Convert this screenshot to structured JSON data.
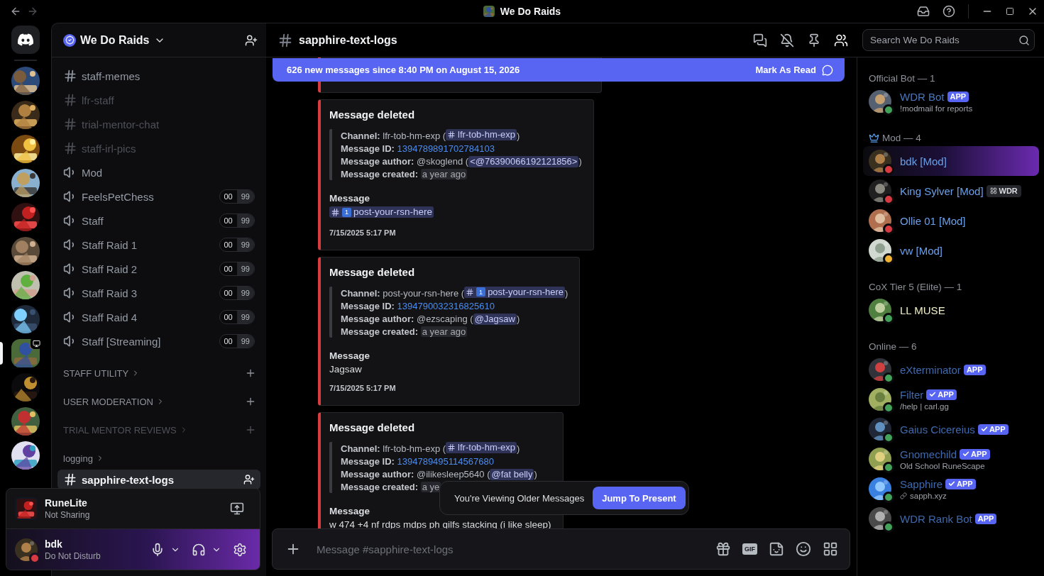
{
  "window": {
    "title": "We Do Raids"
  },
  "servers": [
    {
      "selected": false,
      "live": false
    },
    {
      "selected": false,
      "live": false
    },
    {
      "selected": false,
      "live": false
    },
    {
      "selected": false,
      "live": false
    },
    {
      "selected": false,
      "live": false
    },
    {
      "selected": false,
      "live": false
    },
    {
      "selected": false,
      "live": false
    },
    {
      "selected": false,
      "live": false
    },
    {
      "selected": true,
      "live": true
    },
    {
      "selected": false,
      "live": false
    },
    {
      "selected": false,
      "live": false
    },
    {
      "selected": false,
      "live": false
    }
  ],
  "server_header": {
    "name": "We Do Raids"
  },
  "channels": [
    {
      "kind": "text",
      "name": "staff-memes",
      "muted": false,
      "selected": false
    },
    {
      "kind": "text",
      "name": "lfr-staff",
      "muted": true,
      "selected": false
    },
    {
      "kind": "text",
      "name": "trial-mentor-chat",
      "muted": true,
      "selected": false
    },
    {
      "kind": "text",
      "name": "staff-irl-pics",
      "muted": true,
      "selected": false
    },
    {
      "kind": "voice",
      "name": "Mod",
      "muted": false,
      "selected": false
    },
    {
      "kind": "voice",
      "name": "FeelsPetChess",
      "muted": false,
      "selected": false,
      "count": "00",
      "limit": "99"
    },
    {
      "kind": "voice",
      "name": "Staff",
      "muted": false,
      "selected": false,
      "count": "00",
      "limit": "99"
    },
    {
      "kind": "voice",
      "name": "Staff Raid 1",
      "muted": false,
      "selected": false,
      "count": "00",
      "limit": "99"
    },
    {
      "kind": "voice",
      "name": "Staff Raid 2",
      "muted": false,
      "selected": false,
      "count": "00",
      "limit": "99"
    },
    {
      "kind": "voice",
      "name": "Staff Raid 3",
      "muted": false,
      "selected": false,
      "count": "00",
      "limit": "99"
    },
    {
      "kind": "voice",
      "name": "Staff Raid 4",
      "muted": false,
      "selected": false,
      "count": "00",
      "limit": "99"
    },
    {
      "kind": "voice",
      "name": "Staff [Streaming]",
      "muted": false,
      "selected": false,
      "count": "00",
      "limit": "99"
    },
    {
      "kind": "category",
      "name": "STAFF UTILITY",
      "muted": false,
      "add": true
    },
    {
      "kind": "category",
      "name": "USER MODERATION",
      "muted": false,
      "add": true
    },
    {
      "kind": "category",
      "name": "TRIAL MENTOR REVIEWS",
      "muted": true,
      "add": true
    },
    {
      "kind": "category",
      "name": "logging",
      "muted": false,
      "add": false
    },
    {
      "kind": "text",
      "name": "sapphire-text-logs",
      "muted": false,
      "selected": true
    }
  ],
  "activity": {
    "app": "RuneLite",
    "status": "Not Sharing"
  },
  "user": {
    "name": "bdk",
    "status": "Do Not Disturb",
    "color": "#d83a42"
  },
  "channel_header": {
    "name": "sapphire-text-logs"
  },
  "search": {
    "placeholder": "Search We Do Raids"
  },
  "banner": {
    "text": "626 new messages since 8:40 PM on August 15, 2026",
    "action": "Mark As Read"
  },
  "embeds": [
    {
      "kind": "stub"
    },
    {
      "kind": "embed",
      "title": "Message deleted",
      "fields": [
        {
          "kind": "channel",
          "label": "Channel:",
          "text": "lfr-tob-hm-exp (",
          "mention": "lfr-tob-hm-exp",
          "close": ")"
        },
        {
          "kind": "link",
          "label": "Message ID:",
          "text": "1394789891702784103"
        },
        {
          "kind": "mention",
          "label": "Message author:",
          "text": "@skoglend (",
          "mention": "<@763900661921218​56>",
          "close": ")"
        },
        {
          "kind": "timestamp",
          "label": "Message created:",
          "text": "a year ago"
        }
      ],
      "message_label": "Message",
      "content": {
        "kind": "channel",
        "keycap": "1",
        "mention": "post-your-rsn-here"
      },
      "time": "7/15/2025 5:17 PM"
    },
    {
      "kind": "embed",
      "title": "Message deleted",
      "fields": [
        {
          "kind": "channel",
          "label": "Channel:",
          "text": "post-your-rsn-here (",
          "keycap": "1",
          "mention": "post-your-rsn-here",
          "close": ")"
        },
        {
          "kind": "link",
          "label": "Message ID:",
          "text": "1394790032316825610"
        },
        {
          "kind": "mention",
          "label": "Message author:",
          "text": "@ezscaping (",
          "mention": "@Jagsaw",
          "close": ")"
        },
        {
          "kind": "timestamp",
          "label": "Message created:",
          "text": "a year ago"
        }
      ],
      "message_label": "Message",
      "content": {
        "kind": "text",
        "text": "Jagsaw"
      },
      "time": "7/15/2025 5:17 PM"
    },
    {
      "kind": "embed",
      "title": "Message deleted",
      "fields": [
        {
          "kind": "channel",
          "label": "Channel:",
          "text": "lfr-tob-hm-exp (",
          "mention": "lfr-tob-hm-exp",
          "close": ")"
        },
        {
          "kind": "link",
          "label": "Message ID:",
          "text": "1394789495114567680"
        },
        {
          "kind": "mention",
          "label": "Message author:",
          "text": "@ilikesleep5640 (",
          "mention": "@fat belly",
          "close": ")"
        },
        {
          "kind": "timestamp",
          "label": "Message created:",
          "text": "a ye"
        }
      ],
      "message_label": "Message",
      "content": {
        "kind": "text",
        "text": "w 474 +4 nf rdps mdps ph gilfs stacking (i like sleep)"
      }
    }
  ],
  "toast": {
    "text": "You're Viewing Older Messages",
    "action": "Jump To Present"
  },
  "composer": {
    "placeholder": "Message #sapphire-text-logs",
    "gif_label": "GIF"
  },
  "member_groups": [
    {
      "title": "Official Bot — 1",
      "role_icon": false,
      "color": "#4a78c2",
      "members": [
        {
          "name": "WDR Bot",
          "color": "#43a25a",
          "badge": "APP",
          "verified": false,
          "activity": "!modmail for reports",
          "link": false
        }
      ]
    },
    {
      "title": "Mod — 4",
      "role_icon": true,
      "color": "#6aa0ea",
      "members": [
        {
          "name": "bdk [Mod]",
          "color": "#d83a42",
          "nameplate": true
        },
        {
          "name": "King Sylver [Mod]",
          "color": "#d83a42",
          "nameplate": false,
          "tag": "WDR"
        },
        {
          "name": "Ollie 01 [Mod]",
          "color": "#d83a42",
          "nameplate": false
        },
        {
          "name": "vw [Mod]",
          "color": "#f0b232",
          "nameplate": false
        }
      ]
    },
    {
      "title": "CoX Tier 5 (Elite) — 1",
      "role_icon": false,
      "color": "#f1efc6",
      "members": [
        {
          "name": "LL MUSE",
          "color": "#43a25a"
        }
      ]
    },
    {
      "title": "Online — 6",
      "role_icon": false,
      "color": "#3f6aae",
      "members": [
        {
          "name": "eXterminator",
          "color": "#43a25a",
          "badge": "APP",
          "verified": false
        },
        {
          "name": "Filter",
          "color": "#43a25a",
          "badge": "APP",
          "verified": true,
          "activity": "/help | carl.gg",
          "link": false
        },
        {
          "name": "Gaius Cicereius",
          "color": "#43a25a",
          "badge": "APP",
          "verified": true
        },
        {
          "name": "Gnomechild",
          "color": "#43a25a",
          "badge": "APP",
          "verified": true,
          "activity": "Old School RuneScape",
          "link": false
        },
        {
          "name": "Sapphire",
          "color": "#43a25a",
          "badge": "APP",
          "verified": true,
          "activity": "sapph.xyz",
          "link": true
        },
        {
          "name": "WDR Rank Bot",
          "color": "#43a25a",
          "badge": "APP",
          "verified": false
        }
      ]
    }
  ]
}
